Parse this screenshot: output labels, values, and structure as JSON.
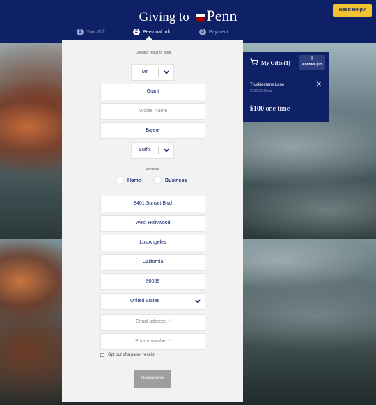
{
  "header": {
    "brand_prefix": "Giving to",
    "brand_name": "Penn",
    "help_label": "Need Help?",
    "steps": [
      {
        "num": "1",
        "label": "Your Gift"
      },
      {
        "num": "2",
        "label": "Personal Info"
      },
      {
        "num": "3",
        "label": "Payment"
      }
    ]
  },
  "form": {
    "required_note": "* Denotes required fields",
    "prefix": "Mr",
    "first_name": "Grant",
    "middle_name_placeholder": "Middle Name",
    "last_name": "Bajere",
    "suffix": "Suffix",
    "address_label": "Address",
    "address_type_home": "Home",
    "address_type_business": "Business",
    "street": "8401 Sunset Blvd",
    "city": "West Hollywood",
    "county": "Los Angeles",
    "state": "California",
    "zip": "90069",
    "country": "United States",
    "email_placeholder": "Email address *",
    "phone_placeholder": "Phone number *",
    "optout_prefix": "Opt ",
    "optout_em": "out",
    "optout_suffix": " of a paper receipt",
    "donate_label": "Donate now"
  },
  "gifts": {
    "title": "My Gifts (1)",
    "another_label": "Another gift",
    "item_name": "Truckiemans Lane",
    "item_amount": "$100.00 Once",
    "total_amount": "$100",
    "total_freq": "one time"
  },
  "colors": {
    "navy": "#0f2166",
    "help_yellow": "#f2c230",
    "panel": "#f2f2f2",
    "donate_disabled": "#9e9e9e"
  }
}
